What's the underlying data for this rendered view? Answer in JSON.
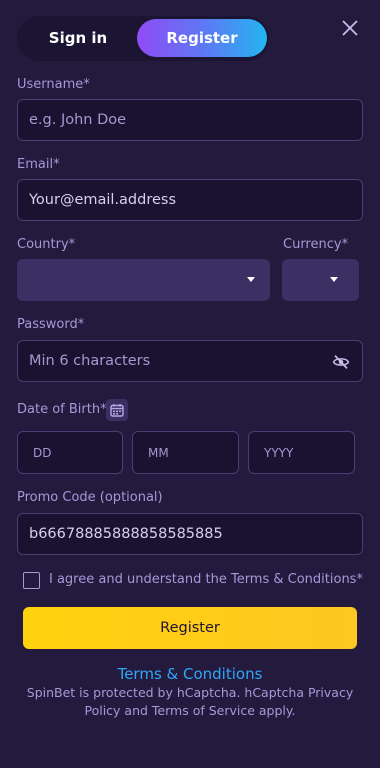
{
  "tabs": {
    "signin": "Sign in",
    "register": "Register"
  },
  "icons": {
    "close": "close-icon",
    "caret": "chevron-down-icon",
    "eye": "eye-off-icon",
    "calendar": "calendar-icon"
  },
  "form": {
    "username": {
      "label": "Username*",
      "placeholder": "e.g. John Doe"
    },
    "email": {
      "label": "Email*",
      "value": "Your@email.address"
    },
    "country": {
      "label": "Country*"
    },
    "currency": {
      "label": "Currency*"
    },
    "password": {
      "label": "Password*",
      "placeholder": "Min 6 characters"
    },
    "dob": {
      "label": "Date of Birth*",
      "day": "DD",
      "month": "MM",
      "year": "YYYY"
    },
    "promo": {
      "label": "Promo Code (optional)",
      "value": "b66678885888858585885"
    },
    "agree": "I agree and understand the Terms & Conditions*",
    "submit": "Register"
  },
  "footer": {
    "terms_link": "Terms & Conditions",
    "notice": "SpinBet is protected by hCaptcha. hCaptcha Privacy Policy and Terms of Service apply."
  },
  "colors": {
    "accent_yellow": "#ffd20d",
    "tab_gradient_start": "#8f4cf5",
    "tab_gradient_end": "#22b6f0",
    "link": "#2fa6f6"
  }
}
